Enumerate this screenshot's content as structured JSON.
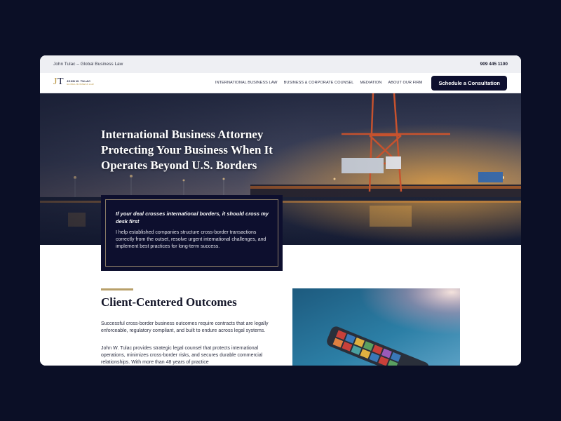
{
  "topbar": {
    "site_title": "John Tulac – Global Business Law",
    "phone": "909 445 1100"
  },
  "logo": {
    "name": "JOHN W. TULAC",
    "subtitle": "GLOBAL BUSINESS LAW"
  },
  "nav": {
    "items": [
      {
        "label": "INTERNATIONAL BUSINESS LAW"
      },
      {
        "label": "BUSINESS & CORPORATE COUNSEL"
      },
      {
        "label": "MEDIATION"
      },
      {
        "label": "ABOUT OUR FIRM"
      }
    ],
    "cta_label": "Schedule a Consultation"
  },
  "hero": {
    "title": "International Business Attorney Protecting Your Business When It Operates Beyond U.S. Borders"
  },
  "quote": {
    "heading": "If your deal crosses international borders, it should cross my desk first",
    "body": "I help established companies structure cross-border transactions correctly from the outset, resolve urgent international challenges, and implement best practices for long-term success."
  },
  "outcomes": {
    "title": "Client-Centered Outcomes",
    "paragraph1": "Successful cross-border business outcomes require contracts that are legally enforceable, regulatory compliant, and built to endure across legal systems.",
    "paragraph2": "John W. Tulac provides strategic legal counsel that protects international operations, minimizes cross-border risks, and secures durable commercial relationships. With more than 48 years of practice"
  },
  "colors": {
    "navy": "#0d0f2e",
    "gold": "#b8a06a",
    "page_bg": "#0b0f26"
  }
}
